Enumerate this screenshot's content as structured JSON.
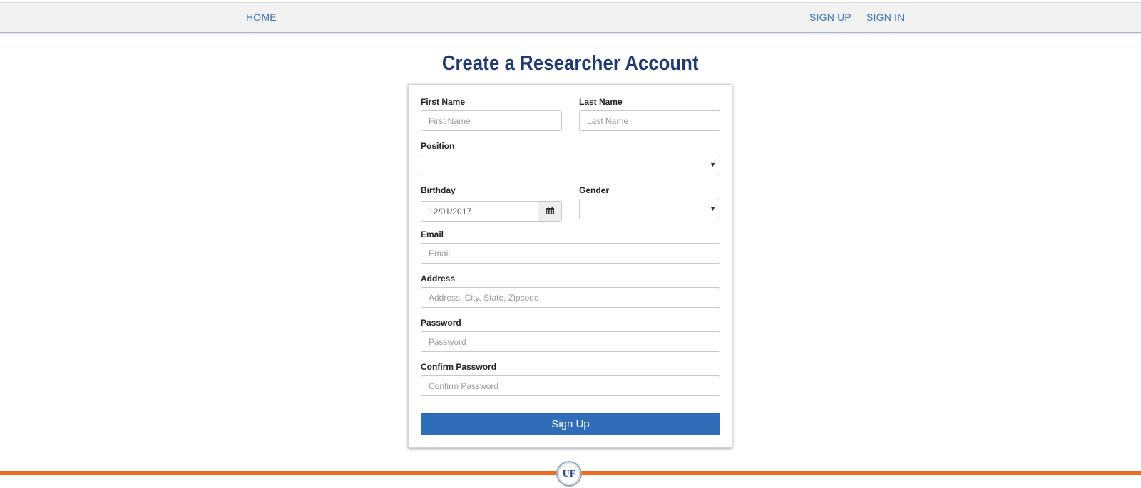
{
  "nav": {
    "home": "HOME",
    "sign_up": "SIGN UP",
    "sign_in": "SIGN IN"
  },
  "page": {
    "title": "Create a Researcher Account"
  },
  "form": {
    "first_name": {
      "label": "First Name",
      "placeholder": "First Name",
      "value": ""
    },
    "last_name": {
      "label": "Last Name",
      "placeholder": "Last Name",
      "value": ""
    },
    "position": {
      "label": "Position",
      "selected": ""
    },
    "birthday": {
      "label": "Birthday",
      "value": "12/01/2017",
      "icon": "calendar-icon"
    },
    "gender": {
      "label": "Gender",
      "selected": ""
    },
    "email": {
      "label": "Email",
      "placeholder": "Email",
      "value": ""
    },
    "address": {
      "label": "Address",
      "placeholder": "Address, City, State, Zipcode",
      "value": ""
    },
    "password": {
      "label": "Password",
      "placeholder": "Password",
      "value": ""
    },
    "confirm_password": {
      "label": "Confirm Password",
      "placeholder": "Confirm Password",
      "value": ""
    },
    "submit_label": "Sign Up"
  },
  "footer": {
    "logo_text": "UF",
    "accent_color": "#f26a20"
  },
  "colors": {
    "link": "#3a73b5",
    "title": "#1d3a76",
    "button": "#2f6db8"
  }
}
